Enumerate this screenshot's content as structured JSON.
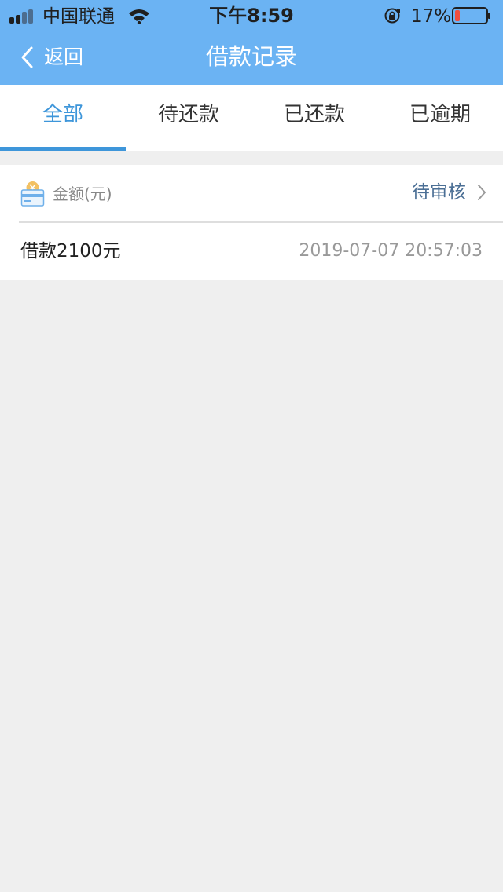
{
  "status_bar": {
    "carrier": "中国联通",
    "time": "下午8:59",
    "battery_percent": "17%",
    "battery_level": 0.17,
    "signal_icon": "signal-bars-icon",
    "wifi_icon": "wifi-icon",
    "lock_icon": "orientation-lock-icon",
    "battery_icon": "battery-icon"
  },
  "nav": {
    "back_label": "返回",
    "back_icon": "chevron-left-icon",
    "title": "借款记录"
  },
  "tabs": [
    {
      "label": "全部",
      "active": true
    },
    {
      "label": "待还款",
      "active": false
    },
    {
      "label": "已还款",
      "active": false
    },
    {
      "label": "已逾期",
      "active": false
    }
  ],
  "records": [
    {
      "icon": "wallet-card-icon",
      "amount_label": "金额(元)",
      "status": "待审核",
      "status_icon": "chevron-right-icon",
      "title": "借款2100元",
      "time": "2019-07-07 20:57:03"
    }
  ],
  "colors": {
    "header_bg": "#6bb3f3",
    "accent": "#3e96da",
    "page_bg": "#efefef",
    "status_text": "#4b6f95",
    "battery_low": "#f24e3f"
  }
}
